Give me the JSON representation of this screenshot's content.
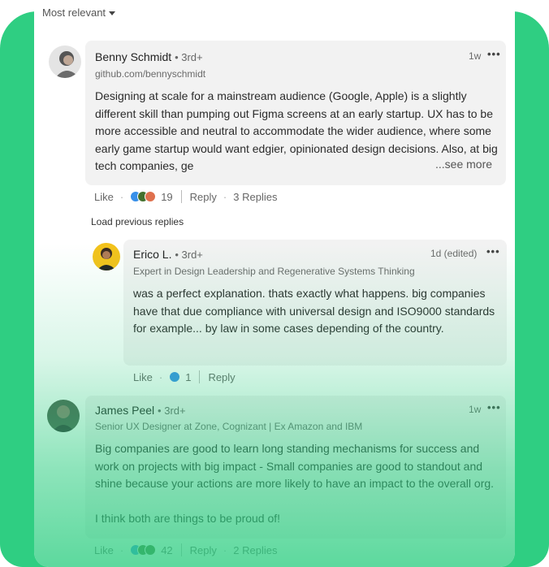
{
  "sort": {
    "label": "Most relevant"
  },
  "load_previous": "Load previous replies",
  "comments": [
    {
      "name": "Benny Schmidt",
      "degree": "• 3rd+",
      "subtitle": "github.com/bennyschmidt",
      "time": "1w",
      "text": "Designing at scale for a mainstream audience (Google, Apple) is a slightly different skill than pumping out Figma screens at an early startup. UX has to be more accessible and neutral to accommodate the wider audience, where some early game startup would want edgier, opinionated design decisions. Also, at big tech companies, ge",
      "see_more": "...see more",
      "like": "Like",
      "reactions_count": "19",
      "reply": "Reply",
      "replies": "3 Replies"
    },
    {
      "name": "Erico L.",
      "degree": "• 3rd+",
      "subtitle": "Expert in Design Leadership and Regenerative Systems Thinking",
      "time": "1d (edited)",
      "text": "was a perfect explanation. thats exactly what happens. big companies have that due compliance with universal design and ISO9000 standards for example... by law in some cases depending of the country.",
      "like": "Like",
      "reactions_count": "1",
      "reply": "Reply"
    },
    {
      "name": "James Peel",
      "degree": "• 3rd+",
      "subtitle": "Senior UX Designer at Zone, Cognizant | Ex Amazon and IBM",
      "time": "1w",
      "text": "Big companies are good to learn long standing mechanisms for success and work on projects with big impact - Small companies are good to standout and shine because your actions are more likely to have an impact to the overall org.",
      "text2": "I think both are things to be proud of!",
      "like": "Like",
      "reactions_count": "42",
      "reply": "Reply",
      "replies": "2 Replies"
    }
  ],
  "colors": {
    "accent_green": "#2fce82",
    "bubble_bg": "#f2f2f2",
    "reaction_like": "#378fe9",
    "reaction_celebrate": "#44712e",
    "reaction_love": "#df704d"
  }
}
